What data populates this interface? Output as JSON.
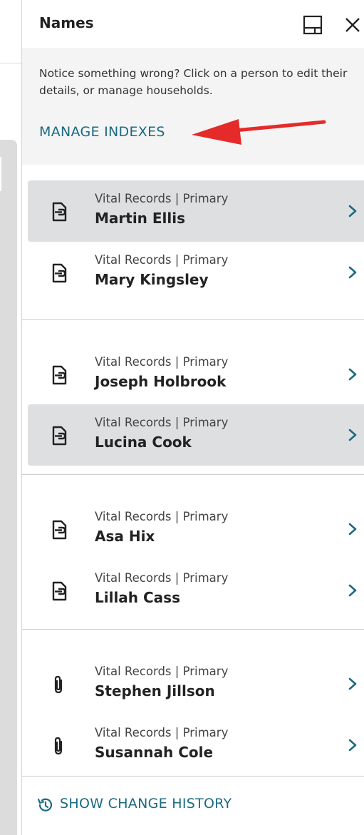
{
  "panel": {
    "title": "Names",
    "dock_icon": "dock-panel-icon",
    "close_icon": "close-icon"
  },
  "notice": {
    "text": "Notice something wrong? Click on a person to edit their details, or manage households.",
    "manage_link": "MANAGE INDEXES",
    "arrow_color": "#e52a2a"
  },
  "groups": [
    {
      "people": [
        {
          "meta": "Vital Records | Primary",
          "name": "Martin Ellis",
          "icon": "document-link-icon",
          "highlighted": true
        },
        {
          "meta": "Vital Records | Primary",
          "name": "Mary Kingsley",
          "icon": "document-link-icon",
          "highlighted": false
        }
      ]
    },
    {
      "people": [
        {
          "meta": "Vital Records | Primary",
          "name": "Joseph Holbrook",
          "icon": "document-link-icon",
          "highlighted": false
        },
        {
          "meta": "Vital Records | Primary",
          "name": "Lucina Cook",
          "icon": "document-link-icon",
          "highlighted": true
        }
      ]
    },
    {
      "people": [
        {
          "meta": "Vital Records | Primary",
          "name": "Asa Hix",
          "icon": "document-link-icon",
          "highlighted": false
        },
        {
          "meta": "Vital Records | Primary",
          "name": "Lillah Cass",
          "icon": "document-link-icon",
          "highlighted": false
        }
      ]
    },
    {
      "people": [
        {
          "meta": "Vital Records | Primary",
          "name": "Stephen Jillson",
          "icon": "paperclip-icon",
          "highlighted": false
        },
        {
          "meta": "Vital Records | Primary",
          "name": "Susannah Cole",
          "icon": "paperclip-icon",
          "highlighted": false
        }
      ]
    }
  ],
  "footer": {
    "history_link": "SHOW CHANGE HISTORY",
    "history_icon": "history-icon"
  },
  "colors": {
    "link": "#1a6b80",
    "highlight_row": "#dedfe0",
    "notice_bg": "#f4f4f4"
  }
}
